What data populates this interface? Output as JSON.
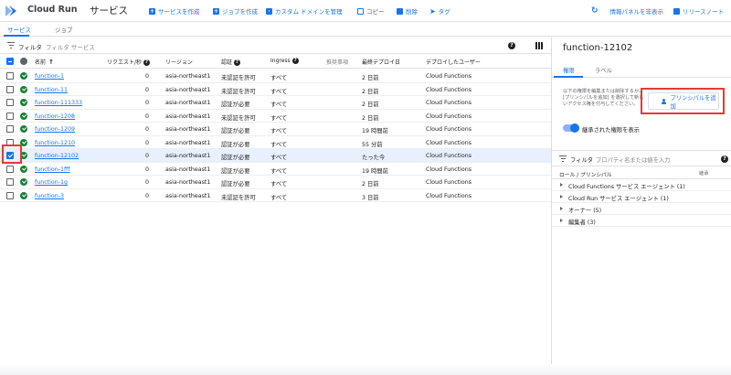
{
  "app": {
    "name": "Cloud Run",
    "page_title": "サービス"
  },
  "toolbar": [
    {
      "name": "create-service-button",
      "icon": "plus-icon",
      "label": "サービスを作成"
    },
    {
      "name": "create-job-button",
      "icon": "plus-icon",
      "label": "ジョブを作成"
    },
    {
      "name": "manage-custom-domains-button",
      "icon": "domain-icon",
      "label": "カスタム ドメインを管理"
    },
    {
      "name": "copy-button",
      "icon": "copy-icon",
      "label": "コピー"
    },
    {
      "name": "delete-button",
      "icon": "trash-icon",
      "label": "削除"
    },
    {
      "name": "tag-button",
      "icon": "tag-icon",
      "label": "タグ"
    },
    {
      "name": "hide-info-panel-button",
      "icon": "refresh-icon",
      "label": "情報パネルを非表示"
    },
    {
      "name": "release-notes-button",
      "icon": "notes-icon",
      "label": "リリースノート"
    }
  ],
  "tabs": [
    "サービス",
    "ジョブ"
  ],
  "filter": {
    "label": "フィルタ",
    "placeholder": "フィルタ サービス"
  },
  "table": {
    "headers": {
      "name": "名前",
      "requests": "リクエスト/秒",
      "region": "リージョン",
      "auth": "認証",
      "ingress": "Ingress",
      "recommendations": "推奨事項",
      "last_deployed": "最終デプロイ日",
      "deployed_by": "デプロイしたユーザー"
    },
    "rows": [
      {
        "name": "function-1",
        "requests": "0",
        "region": "asia-northeast1",
        "auth": "未認証を許可",
        "ingress": "すべて",
        "last_deployed": "2 日前",
        "deployed_by": "Cloud Functions",
        "selected": false
      },
      {
        "name": "function-11",
        "requests": "0",
        "region": "asia-northeast1",
        "auth": "未認証を許可",
        "ingress": "すべて",
        "last_deployed": "2 日前",
        "deployed_by": "Cloud Functions",
        "selected": false
      },
      {
        "name": "function-111333",
        "requests": "0",
        "region": "asia-northeast1",
        "auth": "認証が必要",
        "ingress": "すべて",
        "last_deployed": "2 日前",
        "deployed_by": "Cloud Functions",
        "selected": false
      },
      {
        "name": "function-1208",
        "requests": "0",
        "region": "asia-northeast1",
        "auth": "未認証を許可",
        "ingress": "すべて",
        "last_deployed": "2 日前",
        "deployed_by": "Cloud Functions",
        "selected": false
      },
      {
        "name": "function-1209",
        "requests": "0",
        "region": "asia-northeast1",
        "auth": "認証が必要",
        "ingress": "すべて",
        "last_deployed": "19 時間前",
        "deployed_by": "Cloud Functions",
        "selected": false
      },
      {
        "name": "function-1210",
        "requests": "0",
        "region": "asia-northeast1",
        "auth": "認証が必要",
        "ingress": "すべて",
        "last_deployed": "55 分前",
        "deployed_by": "Cloud Functions",
        "selected": false
      },
      {
        "name": "function-12102",
        "requests": "0",
        "region": "asia-northeast1",
        "auth": "認証が必要",
        "ingress": "すべて",
        "last_deployed": "たった今",
        "deployed_by": "Cloud Functions",
        "selected": true
      },
      {
        "name": "function-1fff",
        "requests": "0",
        "region": "asia-northeast1",
        "auth": "認証が必要",
        "ingress": "すべて",
        "last_deployed": "19 時間前",
        "deployed_by": "Cloud Functions",
        "selected": false
      },
      {
        "name": "function-1g",
        "requests": "0",
        "region": "asia-northeast1",
        "auth": "認証が必要",
        "ingress": "すべて",
        "last_deployed": "2 日前",
        "deployed_by": "Cloud Functions",
        "selected": false
      },
      {
        "name": "function-3",
        "requests": "0",
        "region": "asia-northeast1",
        "auth": "未認証を許可",
        "ingress": "すべて",
        "last_deployed": "3 日前",
        "deployed_by": "Cloud Functions",
        "selected": false
      }
    ]
  },
  "panel": {
    "title": "function-12102",
    "tabs": [
      "権限",
      "ラベル"
    ],
    "description": "以下の権限を編集または削除するか、[プリンシパルを追加] を選択して新しいアクセス権を付与してください。",
    "add_principal_label": "プリンシパルを追加",
    "toggle_label": "継承された権限を表示",
    "filter": {
      "label": "フィルタ",
      "placeholder": "プロパティ名または値を入力"
    },
    "table_header": "ロール / プリンシパル",
    "table_header_right": "継承",
    "roles": [
      "Cloud Functions サービス エージェント (1)",
      "Cloud Run サービス エージェント (1)",
      "オーナー (5)",
      "編集者 (3)"
    ]
  },
  "colors": {
    "accent": "#1a73e8",
    "status_ok": "#188038",
    "highlight": "#e53935"
  }
}
